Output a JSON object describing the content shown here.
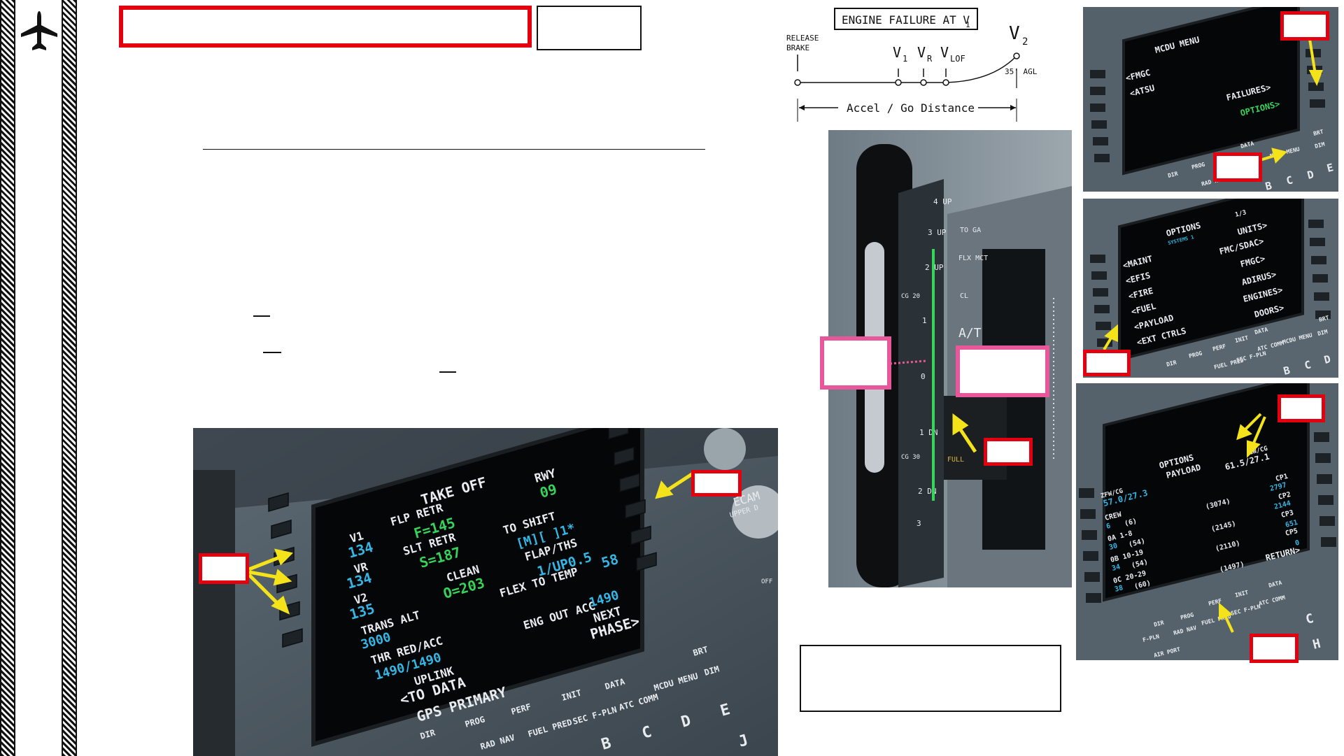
{
  "diagram": {
    "box_title": "ENGINE FAILURE AT V",
    "box_sub": "1",
    "release": "RELEASE",
    "brake": "BRAKE",
    "v1": "V",
    "v1_sub": "1",
    "vr": "V",
    "vr_sub": "R",
    "vlof": "V",
    "vlof_sub": "LOF",
    "v2": "V",
    "v2_sub": "2",
    "agl": "35' AGL",
    "distance": "Accel / Go Distance"
  },
  "mcdu_main": {
    "title": "TAKE OFF",
    "lines": [
      {
        "l": "V1",
        "m": "FLP RETR",
        "r": "RWY"
      },
      {
        "l": "134",
        "m": "F=145",
        "r": "09"
      },
      {
        "l": "VR",
        "m": "SLT RETR",
        "r": "TO SHIFT"
      },
      {
        "l": "134",
        "m": "S=187",
        "r": "[M][  ]1*"
      },
      {
        "l": "V2",
        "m": "CLEAN",
        "r": "FLAP/THS"
      },
      {
        "l": "135",
        "m": "O=203",
        "r": "1/UP0.5"
      },
      {
        "l": "TRANS ALT",
        "m": "",
        "r": "FLEX TO TEMP"
      },
      {
        "l": "3000",
        "m": "",
        "r": "58"
      },
      {
        "l": "THR RED/ACC",
        "m": "",
        "r": "ENG OUT ACC"
      },
      {
        "l": "1490/1490",
        "m": "",
        "r": "1490"
      },
      {
        "l": "UPLINK",
        "m": "",
        "r": "NEXT"
      },
      {
        "l": "<TO DATA",
        "m": "",
        "r": "PHASE>"
      },
      {
        "l": "GPS PRIMARY",
        "m": "",
        "r": ""
      }
    ],
    "keys": [
      "DIR",
      "PROG",
      "PERF",
      "INIT",
      "DATA",
      "MCDU MENU",
      "RAD NAV",
      "FUEL PRED",
      "SEC F-PLN",
      "ATC COMM",
      "BRT",
      "DIM"
    ],
    "letters": [
      "B",
      "C",
      "D",
      "E",
      "J"
    ],
    "ecam": "ECAM",
    "ecam_sub": "UPPER D",
    "off": "OFF"
  },
  "mcdu_menu": {
    "title": "MCDU MENU",
    "left": [
      "<FMGC",
      "<ATSU"
    ],
    "right": [
      "FAILURES>",
      "OPTIONS>"
    ],
    "keys": [
      "DIR",
      "PROG",
      "DATA",
      "MCDU MENU",
      "BRT",
      "DIM",
      "RAD NAV"
    ],
    "letters": [
      "B",
      "C",
      "D",
      "E"
    ]
  },
  "options_systems": {
    "title": "OPTIONS",
    "subtitle": "SYSTEMS 1",
    "page": "1/3",
    "left": [
      "<MAINT",
      "<EFIS",
      "<FIRE",
      "<FUEL",
      "<PAYLOAD",
      "<EXT CTRLS"
    ],
    "right": [
      "UNITS>",
      "FMC/SDAC>",
      "FMGC>",
      "ADIRUS>",
      "ENGINES>",
      "DOORS>"
    ],
    "keys": [
      "DIR",
      "PROG",
      "PERF",
      "INIT",
      "DATA",
      "ATC COMM",
      "MCDU MENU",
      "BRT",
      "DIM",
      "FUEL PRED",
      "SEC F-PLN"
    ],
    "letters": [
      "B",
      "C",
      "D"
    ]
  },
  "options_payload": {
    "title": "OPTIONS",
    "subtitle": "PAYLOAD",
    "zfw_label": "ZFW/CG",
    "zfw": "57.0/27.3",
    "gw_label": "GW/CG",
    "gw": "61.5/27.1",
    "rows": [
      {
        "l1": "CREW",
        "l2": "6",
        "c": "(6)",
        "r1": "CP1",
        "r2": "2797",
        "rc": "(3074)"
      },
      {
        "l1": "0A  1-8",
        "l2": "30",
        "c": "(54)",
        "r1": "CP2",
        "r2": "2144",
        "rc": "(2145)"
      },
      {
        "l1": "0B  10-19",
        "l2": "34",
        "c": "(54)",
        "r1": "CP3",
        "r2": "651",
        "rc": "(2110)"
      },
      {
        "l1": "0C  20-29",
        "l2": "38",
        "c": "(60)",
        "r1": "CP5",
        "r2": "0",
        "rc": "(1497)"
      }
    ],
    "return": "RETURN>",
    "keys": [
      "DIR",
      "PROG",
      "PERF",
      "INIT",
      "DATA",
      "RAD NAV",
      "FUEL PRED",
      "SEC F-PLN",
      "ATC COMM",
      "F-PLN",
      "AIR PORT"
    ],
    "letters": [
      "C",
      "H"
    ]
  },
  "thrust": {
    "toga": "TO GA",
    "flx": "FLX MCT",
    "cl": "CL",
    "at": "A/T",
    "full": "FULL",
    "scale": [
      "4 UP",
      "3 UP",
      "2 UP",
      "1",
      "0",
      "1 DN",
      "2 DN",
      "3"
    ],
    "rev": [
      "CG 20",
      "CG 30"
    ]
  },
  "colors": {
    "callout_red": "#e3000f",
    "callout_pink": "#e8579a",
    "arrow_yellow": "#f4e21a",
    "mcdu_white": "#e8ecef",
    "mcdu_green": "#35d35a",
    "mcdu_cyan": "#33b7e6",
    "panel_gray": "#4a5560"
  },
  "icons": [
    "airplane-icon"
  ]
}
